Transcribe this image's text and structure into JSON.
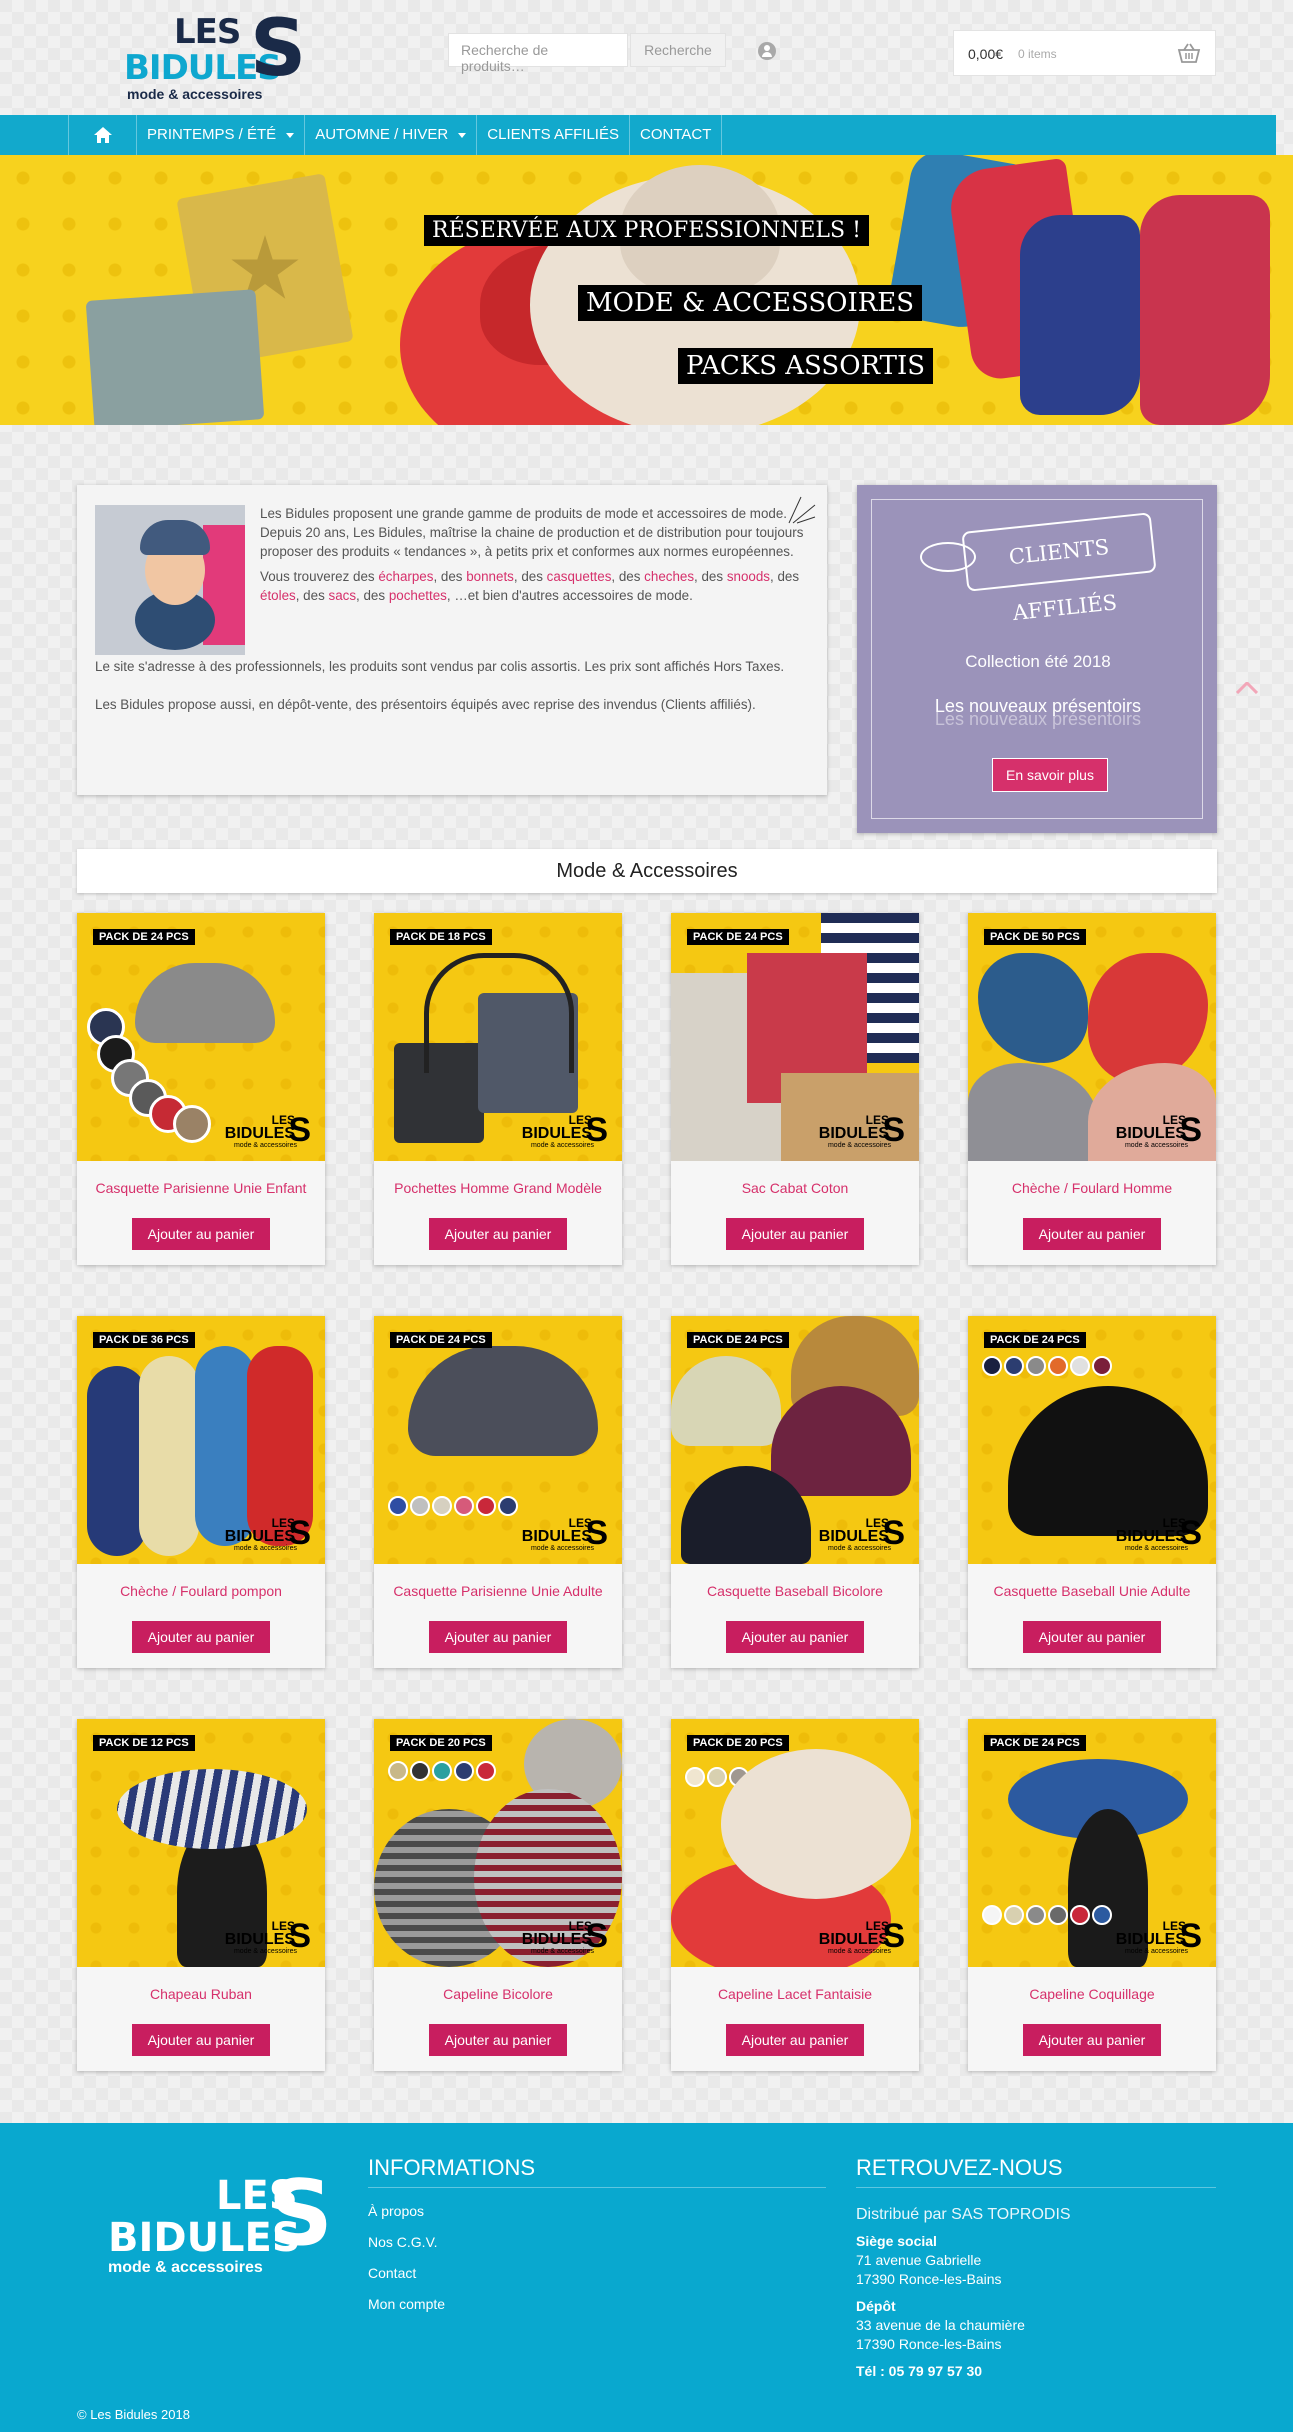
{
  "header": {
    "logo": {
      "les": "LES",
      "bidules": "BIDULES",
      "s": "S",
      "tagline": "mode & accessoires"
    },
    "search": {
      "placeholder": "Recherche de produits…",
      "button": "Recherche"
    },
    "cart": {
      "total": "0,00€",
      "items": "0 items"
    }
  },
  "nav": {
    "items": [
      {
        "label": "PRINTEMPS / ÉTÉ",
        "dropdown": true
      },
      {
        "label": "AUTOMNE / HIVER",
        "dropdown": true
      },
      {
        "label": "CLIENTS AFFILIÉS",
        "dropdown": false
      },
      {
        "label": "CONTACT",
        "dropdown": false
      }
    ]
  },
  "banner": {
    "line1": "RÉSERVÉE AUX PROFESSIONNELS !",
    "line2": "MODE & ACCESSOIRES",
    "line3": "PACKS ASSORTIS"
  },
  "intro": {
    "p1": "Les Bidules proposent une grande gamme de produits de mode et accessoires de mode.",
    "p1b": "Depuis 20 ans, Les Bidules, maîtrise la chaine de production et de distribution pour toujours proposer des produits « tendances », à petits prix et conformes aux normes européennes.",
    "p2_prefix": "Vous trouverez des ",
    "links": [
      "écharpes",
      "bonnets",
      "casquettes",
      "cheches",
      "snoods",
      "étoles",
      "sacs",
      "pochettes"
    ],
    "p2_suffix": "…et bien d'autres accessoires de mode.",
    "p3": "Le site s'adresse à des professionnels, les produits sont vendus par colis assortis. Les prix sont affichés Hors Taxes.",
    "p4": "Les Bidules propose aussi, en dépôt-vente, des présentoirs équipés avec reprise des invendus (Clients affiliés)."
  },
  "clients": {
    "badge": "CLIENTS AFFILIÉS",
    "line1": "Collection été 2018",
    "line2": "Les nouveaux présentoirs",
    "button": "En savoir plus"
  },
  "section_title": "Mode & Accessoires",
  "add_to_cart_label": "Ajouter au panier",
  "products": [
    {
      "pack": "PACK DE 24 PCS",
      "name": "Casquette Parisienne Unie Enfant"
    },
    {
      "pack": "PACK DE 18 PCS",
      "name": "Pochettes Homme Grand Modèle"
    },
    {
      "pack": "PACK DE 24 PCS",
      "name": "Sac Cabat Coton"
    },
    {
      "pack": "PACK DE 50 PCS",
      "name": "Chèche / Foulard Homme"
    },
    {
      "pack": "PACK DE 36 PCS",
      "name": "Chèche / Foulard pompon"
    },
    {
      "pack": "PACK DE 24 PCS",
      "name": "Casquette Parisienne Unie Adulte"
    },
    {
      "pack": "PACK DE 24 PCS",
      "name": "Casquette Baseball Bicolore"
    },
    {
      "pack": "PACK DE 24 PCS",
      "name": "Casquette Baseball Unie Adulte"
    },
    {
      "pack": "PACK DE 12 PCS",
      "name": "Chapeau Ruban"
    },
    {
      "pack": "PACK DE 20 PCS",
      "name": "Capeline Bicolore"
    },
    {
      "pack": "PACK DE 20 PCS",
      "name": "Capeline Lacet Fantaisie"
    },
    {
      "pack": "PACK DE 24 PCS",
      "name": "Capeline Coquillage"
    }
  ],
  "product_logo": {
    "les": "LES",
    "bidules": "BIDULES",
    "s": "S",
    "tagline": "mode & accessoires"
  },
  "footer": {
    "logo": {
      "les": "LES",
      "bidules": "BIDULES",
      "s": "S",
      "tagline": "mode & accessoires"
    },
    "info_title": "INFORMATIONS",
    "info_links": [
      "À propos",
      "Nos C.G.V.",
      "Contact",
      "Mon compte"
    ],
    "ret_title": "RETROUVEZ-NOUS",
    "distributor": "Distribué par SAS TOPRODIS",
    "siege_label": "Siège social",
    "siege_addr1": "71 avenue Gabrielle",
    "siege_addr2": "17390 Ronce-les-Bains",
    "depot_label": "Dépôt",
    "depot_addr1": "33 avenue de la chaumière",
    "depot_addr2": "17390 Ronce-les-Bains",
    "tel": "Tél : 05 79 97 57 30",
    "copyright": "© Les Bidules 2018"
  },
  "colors": {
    "brand_blue": "#12a9cc",
    "navy": "#1a2a48",
    "pink": "#d6306b",
    "button": "#c81e5f",
    "product_bg": "#f5c812",
    "clients_bg": "#9b93ba"
  }
}
